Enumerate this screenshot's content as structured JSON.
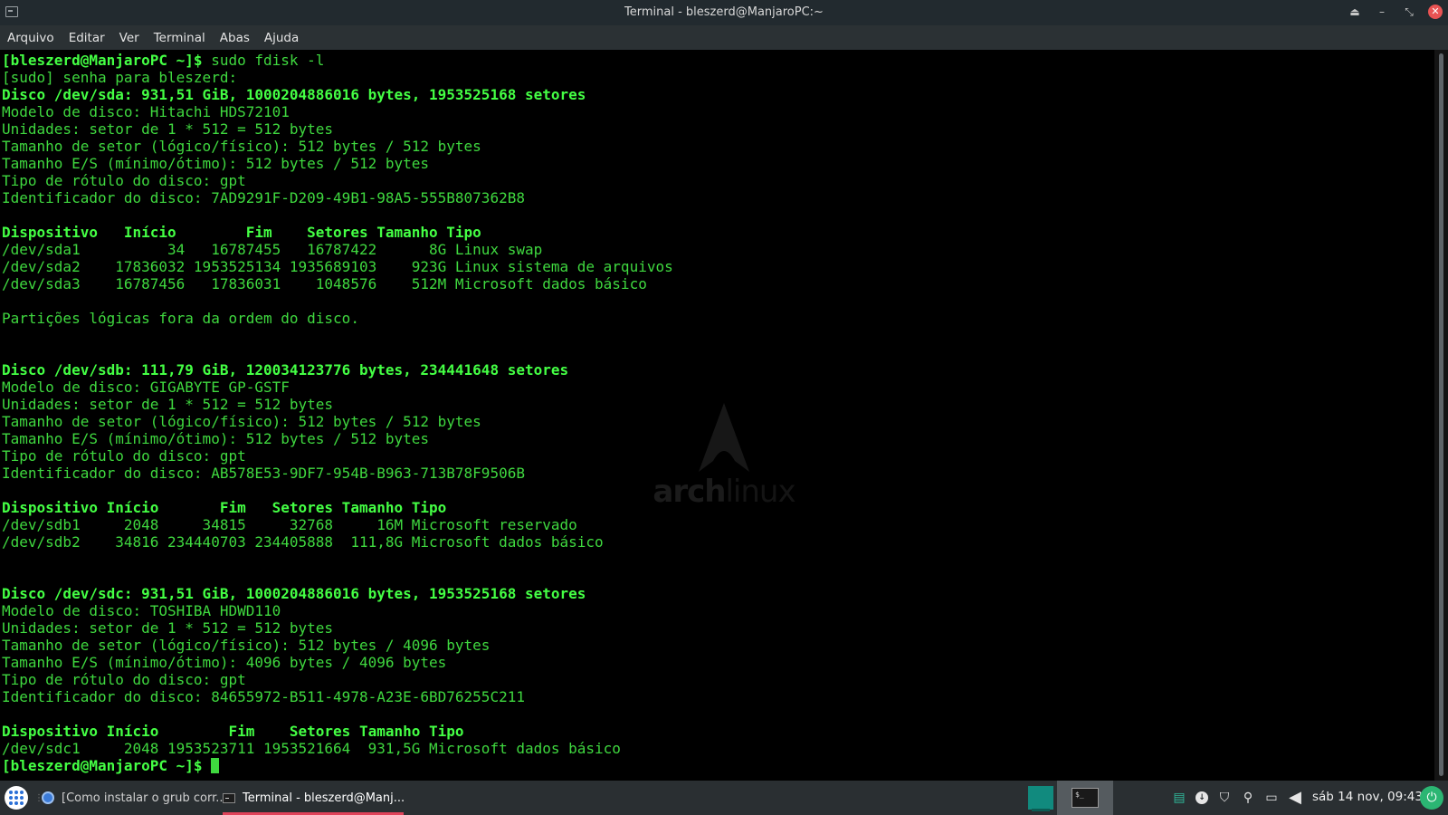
{
  "window": {
    "title": "Terminal - bleszerd@ManjaroPC:~",
    "icons": {
      "app": "terminal-icon",
      "shade": "shade-icon",
      "minimize": "minimize-icon",
      "maximize": "maximize-icon",
      "close": "close-icon"
    }
  },
  "menu": [
    "Arquivo",
    "Editar",
    "Ver",
    "Terminal",
    "Abas",
    "Ajuda"
  ],
  "terminal": {
    "prompt": "[bleszerd@ManjaroPC ~]$ ",
    "command": "sudo fdisk -l",
    "sudo_prompt": "[sudo] senha para bleszerd:",
    "disks": [
      {
        "header": "Disco /dev/sda: 931,51 GiB, 1000204886016 bytes, 1953525168 setores",
        "info": [
          "Modelo de disco: Hitachi HDS72101",
          "Unidades: setor de 1 * 512 = 512 bytes",
          "Tamanho de setor (lógico/físico): 512 bytes / 512 bytes",
          "Tamanho E/S (mínimo/ótimo): 512 bytes / 512 bytes",
          "Tipo de rótulo do disco: gpt",
          "Identificador do disco: 7AD9291F-D209-49B1-98A5-555B807362B8"
        ],
        "table_header": "Dispositivo   Início        Fim    Setores Tamanho Tipo",
        "rows": [
          "/dev/sda1          34   16787455   16787422      8G Linux swap",
          "/dev/sda2    17836032 1953525134 1935689103    923G Linux sistema de arquivos",
          "/dev/sda3    16787456   17836031    1048576    512M Microsoft dados básico"
        ],
        "note": "Partições lógicas fora da ordem do disco."
      },
      {
        "header": "Disco /dev/sdb: 111,79 GiB, 120034123776 bytes, 234441648 setores",
        "info": [
          "Modelo de disco: GIGABYTE GP-GSTF",
          "Unidades: setor de 1 * 512 = 512 bytes",
          "Tamanho de setor (lógico/físico): 512 bytes / 512 bytes",
          "Tamanho E/S (mínimo/ótimo): 512 bytes / 512 bytes",
          "Tipo de rótulo do disco: gpt",
          "Identificador do disco: AB578E53-9DF7-954B-B963-713B78F9506B"
        ],
        "table_header": "Dispositivo Início       Fim   Setores Tamanho Tipo",
        "rows": [
          "/dev/sdb1     2048     34815     32768     16M Microsoft reservado",
          "/dev/sdb2    34816 234440703 234405888  111,8G Microsoft dados básico"
        ],
        "note": ""
      },
      {
        "header": "Disco /dev/sdc: 931,51 GiB, 1000204886016 bytes, 1953525168 setores",
        "info": [
          "Modelo de disco: TOSHIBA HDWD110",
          "Unidades: setor de 1 * 512 = 512 bytes",
          "Tamanho de setor (lógico/físico): 512 bytes / 4096 bytes",
          "Tamanho E/S (mínimo/ótimo): 4096 bytes / 4096 bytes",
          "Tipo de rótulo do disco: gpt",
          "Identificador do disco: 84655972-B511-4978-A23E-6BD76255C211"
        ],
        "table_header": "Dispositivo Início        Fim    Setores Tamanho Tipo",
        "rows": [
          "/dev/sdc1     2048 1953523711 1953521664  931,5G Microsoft dados básico"
        ],
        "note": ""
      }
    ],
    "background_logo": {
      "bold": "arch",
      "light": "linux"
    },
    "colors": {
      "text": "#3fd83f",
      "bold_text": "#44ff44",
      "background": "#000000"
    }
  },
  "taskbar": {
    "tasks": [
      {
        "label": "[Como instalar o grub corr...",
        "icon": "browser-icon"
      },
      {
        "label": "Terminal - bleszerd@Manj...",
        "icon": "terminal-icon",
        "active": true
      }
    ],
    "workspace_icon": "terminal-window-icon",
    "tray_icons": [
      "network-icon",
      "update-icon",
      "shield-icon",
      "paperclip-icon",
      "screen-icon",
      "volume-icon"
    ],
    "clock": "sáb 14 nov, 09:43",
    "power_icon": "power-icon",
    "accent": "#e0435a"
  }
}
